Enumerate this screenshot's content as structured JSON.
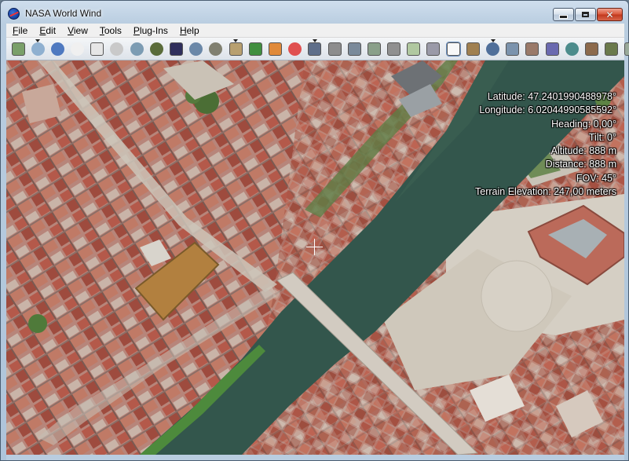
{
  "window": {
    "title": "NASA World Wind",
    "controls": {
      "minimize": "minimize",
      "maximize": "maximize",
      "close": "close"
    }
  },
  "menu": [
    {
      "label": "File",
      "accel": "F",
      "rest": "ile"
    },
    {
      "label": "Edit",
      "accel": "E",
      "rest": "dit"
    },
    {
      "label": "View",
      "accel": "V",
      "rest": "iew"
    },
    {
      "label": "Tools",
      "accel": "T",
      "rest": "ools"
    },
    {
      "label": "Plug-Ins",
      "accel": "P",
      "rest": "lug-Ins"
    },
    {
      "label": "Help",
      "accel": "H",
      "rest": "elp"
    }
  ],
  "toolbar": [
    {
      "name": "layers-icon",
      "color": "#7aa06a",
      "shape": "sq"
    },
    {
      "name": "crosshair-toggle-icon",
      "color": "#8fb0d0",
      "shape": "circle",
      "drop": true
    },
    {
      "name": "compass-icon",
      "color": "#4e79c0",
      "shape": "circle"
    },
    {
      "name": "clock-icon",
      "color": "#f0f0f0",
      "shape": "circle"
    },
    {
      "name": "home-icon",
      "color": "#e6e6e6",
      "shape": "sq"
    },
    {
      "name": "search-icon",
      "color": "#c9c9c9",
      "shape": "circle"
    },
    {
      "name": "sphere-icon",
      "color": "#7c9cb3",
      "shape": "circle"
    },
    {
      "name": "globe-icon",
      "color": "#5a6c3a",
      "shape": "circle"
    },
    {
      "name": "landsat-icon",
      "color": "#2f2f5c",
      "shape": "sq"
    },
    {
      "name": "world-icon",
      "color": "#6a88a8",
      "shape": "circle"
    },
    {
      "name": "moon-icon",
      "color": "#808070",
      "shape": "circle"
    },
    {
      "name": "terrain-icon",
      "color": "#b8a070",
      "shape": "sq",
      "drop": true
    },
    {
      "name": "color-map-icon",
      "color": "#3f8f3f",
      "shape": "sq"
    },
    {
      "name": "heat-map-icon",
      "color": "#e08a3a",
      "shape": "sq"
    },
    {
      "name": "rainbow-icon",
      "color": "#e05050",
      "shape": "circle"
    },
    {
      "name": "animated-clouds-icon",
      "color": "#5f6f8a",
      "shape": "sq",
      "drop": true
    },
    {
      "name": "satellite-image-icon",
      "color": "#8d8d8d",
      "shape": "sq"
    },
    {
      "name": "modis-icon",
      "color": "#7a8a9a",
      "shape": "sq"
    },
    {
      "name": "geocover-icon",
      "color": "#8aa08a",
      "shape": "sq"
    },
    {
      "name": "zoomit-icon",
      "color": "#909090",
      "shape": "sq"
    },
    {
      "name": "usgs-topo-icon",
      "color": "#b0c8a0",
      "shape": "sq"
    },
    {
      "name": "usgs-urban-icon",
      "color": "#9a9aa8",
      "shape": "sq"
    },
    {
      "name": "blank-map-icon",
      "color": "#f8f8f8",
      "shape": "sq",
      "selected": true
    },
    {
      "name": "ruler-icon",
      "color": "#a08050",
      "shape": "sq"
    },
    {
      "name": "zoom-search-icon",
      "color": "#4f6f9a",
      "shape": "circle",
      "drop": true
    },
    {
      "name": "grid-icon",
      "color": "#7b93ad",
      "shape": "sq"
    },
    {
      "name": "photo-layers-icon",
      "color": "#9a7a6a",
      "shape": "sq"
    },
    {
      "name": "flags-icon",
      "color": "#6a6ab0",
      "shape": "sq"
    },
    {
      "name": "boundaries-icon",
      "color": "#4c8c8c",
      "shape": "circle"
    },
    {
      "name": "places-icon",
      "color": "#8c6a4c",
      "shape": "sq"
    },
    {
      "name": "stars-icon",
      "color": "#6a7a4c",
      "shape": "sq"
    },
    {
      "name": "scripts-icon",
      "color": "#9aaa9a",
      "shape": "sq"
    }
  ],
  "readout": {
    "latitude": "Latitude: 47.2401990488978°",
    "longitude": "Longitude: 6.02044990585592°",
    "heading": "Heading: 0,00°",
    "tilt": "Tilt: 0°",
    "altitude": "Altitude: 888 m",
    "distance": "Distance: 888 m",
    "fov": "FOV: 45°",
    "terrain_elevation": "Terrain Elevation: 247,00 meters"
  },
  "colors": {
    "river": "#33564c",
    "rooftops": "#b46b57",
    "pavement": "#cfc8bc",
    "vegetation": "#4f7a3a"
  }
}
